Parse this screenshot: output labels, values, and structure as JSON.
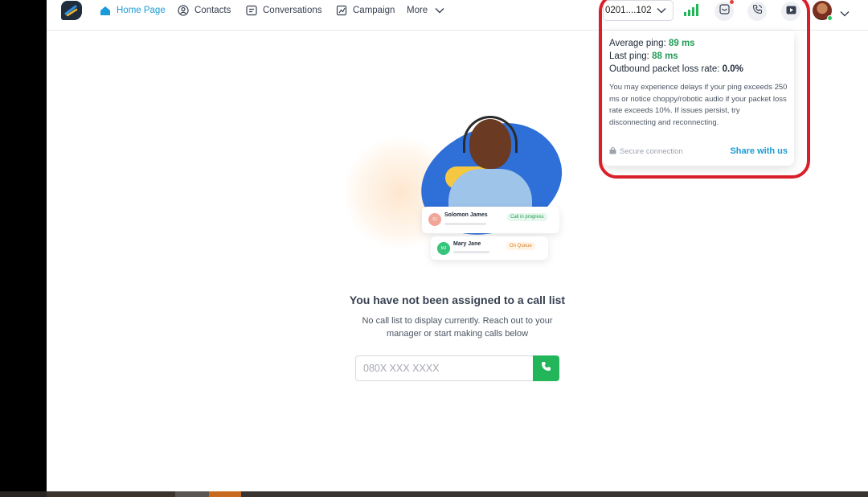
{
  "nav": {
    "items": [
      {
        "label": "Home Page",
        "icon": "home-icon",
        "active": true
      },
      {
        "label": "Contacts",
        "icon": "contacts-icon",
        "active": false
      },
      {
        "label": "Conversations",
        "icon": "conversations-icon",
        "active": false
      },
      {
        "label": "Campaign",
        "icon": "campaign-icon",
        "active": false
      },
      {
        "label": "More",
        "icon": "chevron-down-icon",
        "active": false
      }
    ]
  },
  "header": {
    "phone_number": "0201....102",
    "icons": [
      "signal-bars-icon",
      "inbox-icon",
      "phone-icon",
      "video-icon",
      "avatar",
      "chevron-down-icon"
    ]
  },
  "network_popover": {
    "average_ping_label": "Average ping:",
    "average_ping_value": "89 ms",
    "last_ping_label": "Last ping:",
    "last_ping_value": "88 ms",
    "packet_loss_label": "Outbound packet loss rate:",
    "packet_loss_value": "0.0%",
    "note": "You may experience delays if your ping exceeds 250 ms or notice choppy/robotic audio if your packet loss rate exceeds 10%. If issues persist, try disconnecting and reconnecting.",
    "secure_label": "Secure connection",
    "share_label": "Share with us"
  },
  "illustration": {
    "card1": {
      "initials": "SJ",
      "name": "Solomon James",
      "status": "Call in progress"
    },
    "card2": {
      "initials": "MJ",
      "name": "Mary Jane",
      "status": "On Queue"
    }
  },
  "empty_state": {
    "title": "You have not been assigned to a call list",
    "subtitle": "No call list to display currently. Reach out to your manager or start making calls below"
  },
  "dialer": {
    "placeholder": "080X XXX XXXX"
  },
  "colors": {
    "accent": "#1a9bd7",
    "green": "#22b55a",
    "highlight_red": "#d9202a"
  }
}
